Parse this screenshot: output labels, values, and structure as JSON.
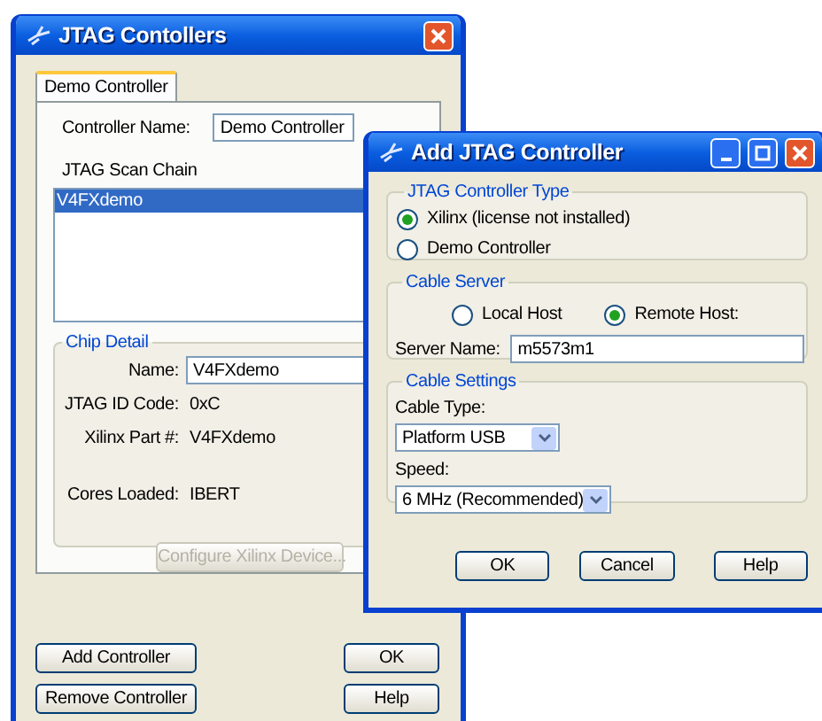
{
  "main_window": {
    "title": "JTAG Contollers",
    "tabs": [
      {
        "label": "Demo Controller",
        "selected": true
      }
    ],
    "controller_name": {
      "label": "Controller Name:",
      "value": "Demo Controller"
    },
    "scan_chain": {
      "label": "JTAG Scan Chain",
      "items": [
        {
          "label": "V4FXdemo",
          "selected": true
        }
      ]
    },
    "chip_detail": {
      "title": "Chip Detail",
      "name": {
        "label": "Name:",
        "value": "V4FXdemo"
      },
      "fields": [
        {
          "label": "JTAG ID Code:",
          "value": "0xC"
        },
        {
          "label": "Xilinx Part #:",
          "value": "V4FXdemo"
        },
        {
          "label": "Cores Loaded:",
          "value": "IBERT"
        }
      ],
      "configure_button": {
        "label": "Configure Xilinx Device...",
        "disabled": true
      }
    },
    "buttons": [
      {
        "label": "Add Controller"
      },
      {
        "label": "OK"
      },
      {
        "label": "Remove Controller"
      },
      {
        "label": "Help"
      }
    ]
  },
  "dialog": {
    "title": "Add JTAG Controller",
    "controller_type": {
      "title": "JTAG Controller Type",
      "options": [
        {
          "label": "Xilinx (license not installed)",
          "selected": true
        },
        {
          "label": "Demo Controller",
          "selected": false
        }
      ]
    },
    "cable_server": {
      "title": "Cable Server",
      "options": [
        {
          "label": "Local Host",
          "selected": false
        },
        {
          "label": "Remote Host:",
          "selected": true
        }
      ],
      "server_name": {
        "label": "Server Name:",
        "value": "m5573m1"
      }
    },
    "cable_settings": {
      "title": "Cable Settings",
      "cable_type": {
        "label": "Cable Type:",
        "value": "Platform USB"
      },
      "speed": {
        "label": "Speed:",
        "value": "6 MHz (Recommended)"
      }
    },
    "buttons": [
      {
        "label": "OK"
      },
      {
        "label": "Cancel"
      },
      {
        "label": "Help"
      }
    ]
  }
}
